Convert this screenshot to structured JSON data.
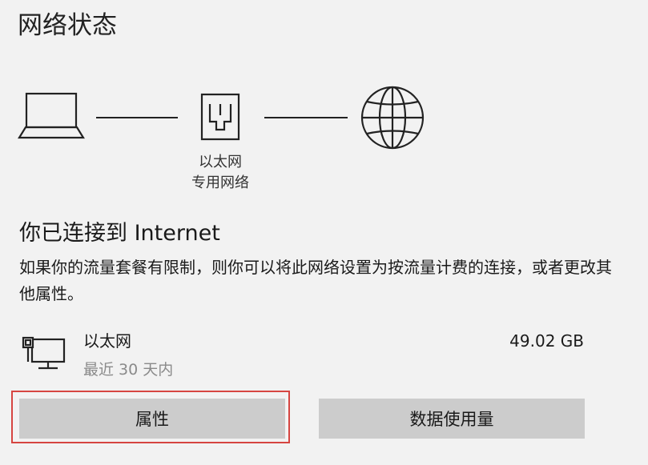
{
  "header": {
    "title": "网络状态"
  },
  "diagram": {
    "nodes": [
      {
        "icon": "laptop-icon"
      },
      {
        "icon": "ethernet-icon",
        "label_line1": "以太网",
        "label_line2": "专用网络"
      },
      {
        "icon": "globe-icon"
      }
    ]
  },
  "status": {
    "heading": "你已连接到 Internet",
    "description": "如果你的流量套餐有限制，则你可以将此网络设置为按流量计费的连接，或者更改其他属性。"
  },
  "adapter": {
    "icon": "network-monitor-icon",
    "name": "以太网",
    "period": "最近 30 天内",
    "usage": "49.02 GB"
  },
  "buttons": {
    "properties": "属性",
    "data_usage": "数据使用量"
  },
  "colors": {
    "background": "#f2f2f2",
    "button": "#cccccc",
    "highlight": "#d64541"
  }
}
